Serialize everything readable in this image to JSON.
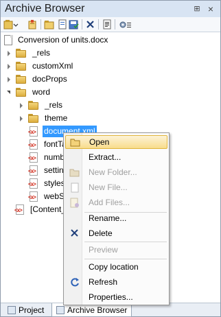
{
  "window": {
    "title": "Archive Browser"
  },
  "title_controls": {
    "pin": "⊞",
    "close": "×"
  },
  "toolbar": {
    "icons": [
      "new-archive-icon",
      "add-files-icon",
      "folder-icon",
      "document-icon",
      "delete-icon",
      "properties-icon",
      "settings-icon"
    ]
  },
  "tree": {
    "root": "Conversion of units.docx",
    "items": [
      {
        "label": "_rels",
        "type": "folder"
      },
      {
        "label": "customXml",
        "type": "folder"
      },
      {
        "label": "docProps",
        "type": "folder"
      },
      {
        "label": "word",
        "type": "folder"
      },
      {
        "label": "_rels",
        "type": "folder"
      },
      {
        "label": "theme",
        "type": "folder"
      },
      {
        "label": "document.xml",
        "type": "xml"
      },
      {
        "label": "fontTa",
        "type": "xml"
      },
      {
        "label": "numbe",
        "type": "xml"
      },
      {
        "label": "setting",
        "type": "xml"
      },
      {
        "label": "styles.",
        "type": "xml"
      },
      {
        "label": "webSe",
        "type": "xml"
      },
      {
        "label": "[Content_",
        "type": "xml"
      }
    ]
  },
  "context_menu": {
    "items": [
      {
        "label": "Open",
        "icon": "open-folder-icon",
        "enabled": true,
        "hover": true
      },
      {
        "label": "Extract...",
        "icon": "",
        "enabled": true
      },
      {
        "label": "New Folder...",
        "icon": "new-folder-icon",
        "enabled": false
      },
      {
        "label": "New File...",
        "icon": "new-file-icon",
        "enabled": false
      },
      {
        "label": "Add Files...",
        "icon": "add-files-icon",
        "enabled": false
      },
      {
        "label": "Rename...",
        "icon": "",
        "enabled": true
      },
      {
        "label": "Delete",
        "icon": "delete-icon",
        "enabled": true
      },
      {
        "label": "Preview",
        "icon": "",
        "enabled": false
      },
      {
        "label": "Copy location",
        "icon": "",
        "enabled": true
      },
      {
        "label": "Refresh",
        "icon": "refresh-icon",
        "enabled": true
      },
      {
        "label": "Properties...",
        "icon": "",
        "enabled": true
      }
    ]
  },
  "bottom_tabs": [
    {
      "label": "Project",
      "active": false
    },
    {
      "label": "Archive Browser",
      "active": true
    }
  ],
  "colors": {
    "selection": "#3399ff",
    "menu_hover": "#f8dc8c",
    "titlebar": "#d8e4f3"
  }
}
